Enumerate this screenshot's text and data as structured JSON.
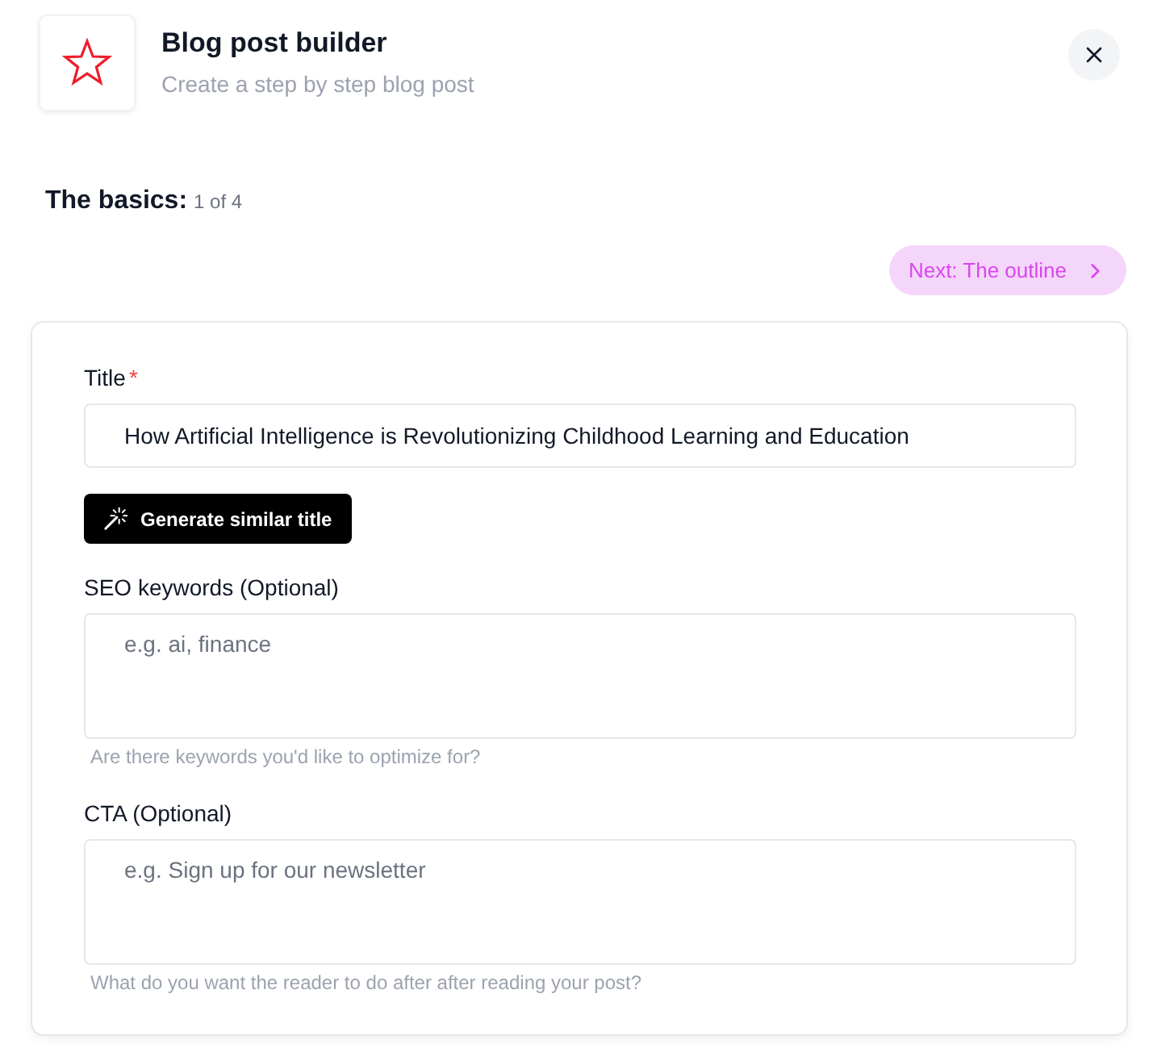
{
  "header": {
    "title": "Blog post builder",
    "subtitle": "Create a step by step blog post"
  },
  "step": {
    "title": "The basics:",
    "counter": "1 of 4"
  },
  "next_button": {
    "label": "Next: The outline"
  },
  "form": {
    "fields": [
      {
        "kind": "input",
        "label": "Title",
        "required_mark": "*",
        "value": "How Artificial Intelligence is Revolutionizing Childhood Learning and Education",
        "action": {
          "label": "Generate similar title"
        }
      },
      {
        "kind": "textarea",
        "label": "SEO keywords (Optional)",
        "placeholder": "e.g. ai, finance",
        "hint": "Are there keywords you'd like to optimize for?"
      },
      {
        "kind": "textarea",
        "label": "CTA (Optional)",
        "placeholder": "e.g. Sign up for our newsletter",
        "hint": "What do you want the reader to do after after reading your post?"
      }
    ]
  }
}
